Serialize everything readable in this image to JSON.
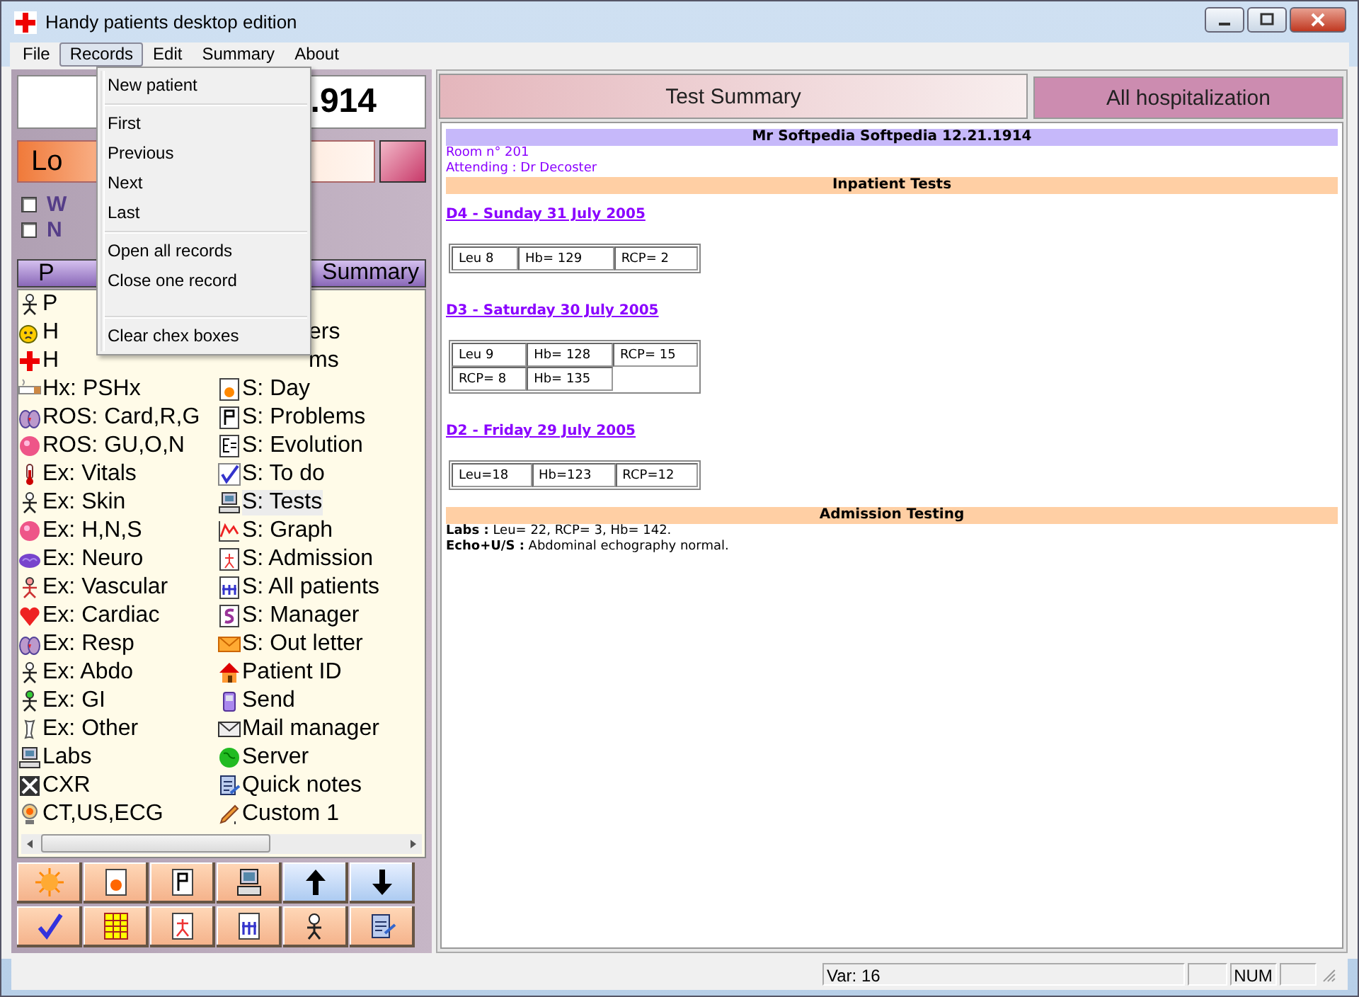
{
  "window": {
    "title": "Handy patients desktop edition"
  },
  "menu_bar": [
    {
      "label": "File",
      "selected": false
    },
    {
      "label": "Records",
      "selected": true
    },
    {
      "label": "Edit",
      "selected": false
    },
    {
      "label": "Summary",
      "selected": false
    },
    {
      "label": "About",
      "selected": false
    }
  ],
  "open_menu": {
    "items": [
      {
        "kind": "item",
        "label": "New patient"
      },
      {
        "kind": "separator"
      },
      {
        "kind": "item",
        "label": "First"
      },
      {
        "kind": "item",
        "label": "Previous"
      },
      {
        "kind": "item",
        "label": "Next"
      },
      {
        "kind": "item",
        "label": "Last"
      },
      {
        "kind": "separator"
      },
      {
        "kind": "item",
        "label": "Open all records"
      },
      {
        "kind": "item",
        "label": "Close one record"
      },
      {
        "kind": "spacer"
      },
      {
        "kind": "separator"
      },
      {
        "kind": "item",
        "label": "Clear chex boxes"
      }
    ]
  },
  "left_panel": {
    "name_field": ".914",
    "location_bar": "Lo",
    "checkboxes": [
      {
        "label": "W",
        "checked": false
      },
      {
        "label": "N",
        "checked": false
      }
    ],
    "tabs": [
      {
        "label": "P",
        "selected": false
      },
      {
        "label": "Summary",
        "selected": false
      }
    ],
    "list_columns": [
      {
        "items": [
          {
            "kind": "full",
            "label": "P",
            "selected": false
          },
          {
            "kind": "full",
            "label": "H",
            "selected": false
          },
          {
            "kind": "full",
            "label": "H",
            "selected": false
          },
          {
            "kind": "full",
            "label": "Hx: PSHx",
            "selected": false
          },
          {
            "kind": "full",
            "label": "ROS: Card,R,G",
            "selected": false
          },
          {
            "kind": "full",
            "label": "ROS: GU,O,N",
            "selected": false
          },
          {
            "kind": "full",
            "label": "Ex: Vitals",
            "selected": false
          },
          {
            "kind": "full",
            "label": "Ex: Skin",
            "selected": false
          },
          {
            "kind": "full",
            "label": "Ex: H,N,S",
            "selected": false
          },
          {
            "kind": "full",
            "label": "Ex: Neuro",
            "selected": false
          },
          {
            "kind": "full",
            "label": "Ex: Vascular",
            "selected": false
          },
          {
            "kind": "full",
            "label": "Ex: Cardiac",
            "selected": false
          },
          {
            "kind": "full",
            "label": "Ex: Resp",
            "selected": false
          },
          {
            "kind": "full",
            "label": "Ex: Abdo",
            "selected": false
          },
          {
            "kind": "full",
            "label": "Ex: GI",
            "selected": false
          },
          {
            "kind": "full",
            "label": "Ex: Other",
            "selected": false
          },
          {
            "kind": "full",
            "label": "Labs",
            "selected": false
          },
          {
            "kind": "full",
            "label": "CXR",
            "selected": false
          },
          {
            "kind": "full",
            "label": "CT,US,ECG",
            "selected": false
          }
        ]
      },
      {
        "items": [
          {
            "kind": "partial",
            "label": "ers",
            "selected": false
          },
          {
            "kind": "partial",
            "label": "ms",
            "selected": false
          },
          {
            "kind": "full",
            "label": "S: Day",
            "selected": false
          },
          {
            "kind": "full",
            "label": "S: Problems",
            "selected": false
          },
          {
            "kind": "full",
            "label": "S: Evolution",
            "selected": false
          },
          {
            "kind": "full",
            "label": "S: To do",
            "selected": false
          },
          {
            "kind": "full",
            "label": "S: Tests",
            "selected": true
          },
          {
            "kind": "full",
            "label": "S: Graph",
            "selected": false
          },
          {
            "kind": "full",
            "label": "S: Admission",
            "selected": false
          },
          {
            "kind": "full",
            "label": "S: All patients",
            "selected": false
          },
          {
            "kind": "full",
            "label": "S: Manager",
            "selected": false
          },
          {
            "kind": "full",
            "label": "S: Out letter",
            "selected": false
          },
          {
            "kind": "full",
            "label": "Patient ID",
            "selected": false
          },
          {
            "kind": "full",
            "label": "Send",
            "selected": false
          },
          {
            "kind": "full",
            "label": "Mail manager",
            "selected": false
          },
          {
            "kind": "full",
            "label": "Server",
            "selected": false
          },
          {
            "kind": "full",
            "label": "Quick notes",
            "selected": false
          },
          {
            "kind": "full",
            "label": "Custom 1",
            "selected": false
          }
        ]
      }
    ]
  },
  "right_panel": {
    "tabs": [
      {
        "label": "Test Summary",
        "selected": true
      },
      {
        "label": "All hospitalization",
        "selected": false
      }
    ],
    "patient_header": "Mr Softpedia Softpedia 12.21.1914",
    "room": "Room n° 201",
    "attending": "Attending : Dr Decoster",
    "blocks": [
      {
        "kind": "section",
        "text": "Inpatient Tests"
      },
      {
        "kind": "day",
        "title": "D4 - Sunday 31 July 2005",
        "rows": [
          [
            "Leu 8",
            "Hb= 129",
            "RCP= 2"
          ]
        ]
      },
      {
        "kind": "day",
        "title": "D3 - Saturday 30 July 2005",
        "rows": [
          [
            "Leu 9",
            "Hb= 128",
            "RCP= 15"
          ],
          [
            "RCP= 8",
            "Hb= 135"
          ]
        ]
      },
      {
        "kind": "day",
        "title": "D2 - Friday 29 July 2005",
        "rows": [
          [
            "Leu=18",
            "Hb=123",
            "RCP=12"
          ]
        ]
      },
      {
        "kind": "section",
        "text": "Admission Testing"
      },
      {
        "kind": "line",
        "text": "**Labs :** Leu= 22, RCP= 3, Hb= 142."
      },
      {
        "kind": "line",
        "text": "**Echo+U/S :** Abdominal echography normal."
      }
    ]
  },
  "status_bar": {
    "variable": "Var: 16",
    "num_lock": "NUM"
  }
}
